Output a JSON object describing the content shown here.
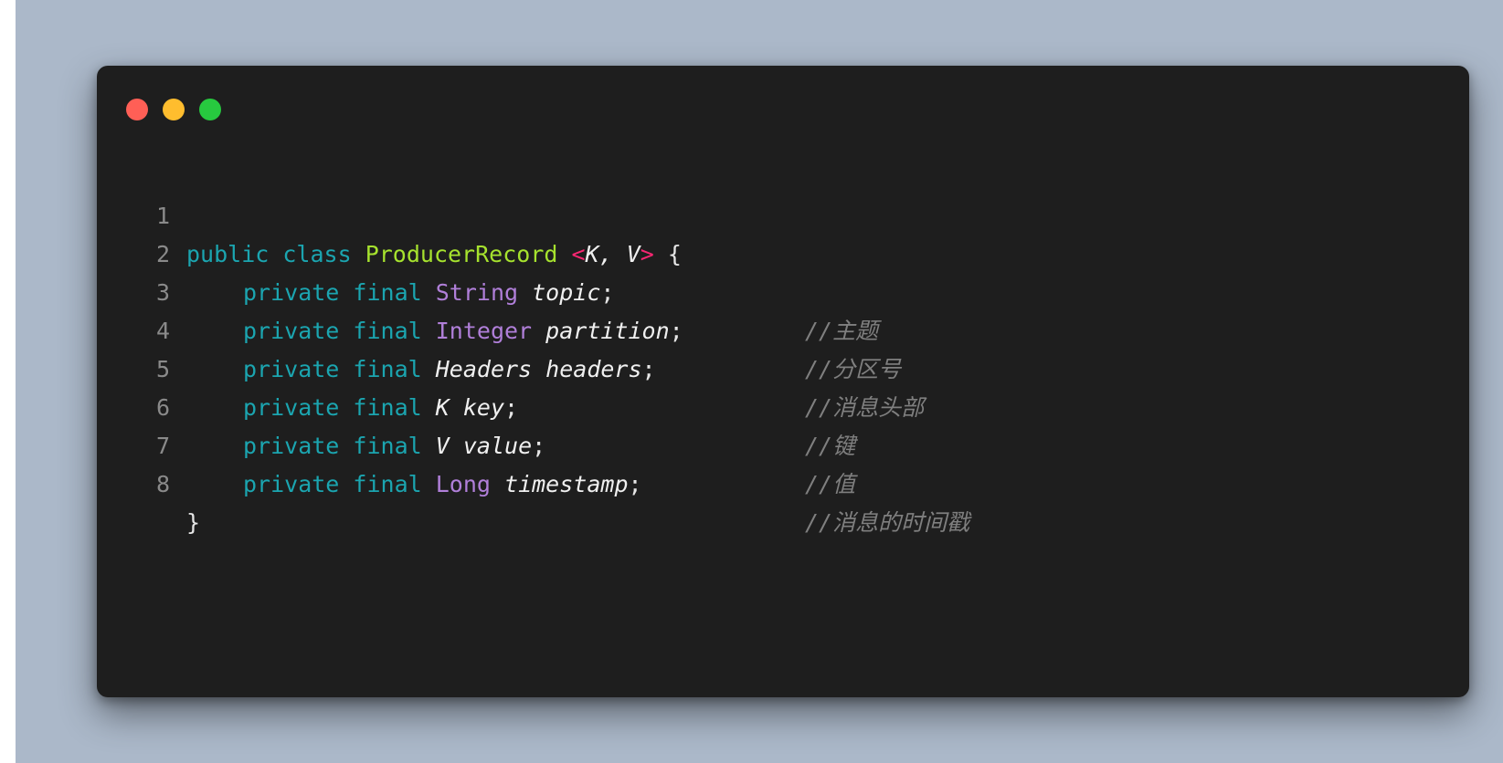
{
  "window": {
    "buttons": [
      {
        "name": "close",
        "color": "#ff5f56"
      },
      {
        "name": "minimize",
        "color": "#ffbd2e"
      },
      {
        "name": "maximize",
        "color": "#27c93f"
      }
    ]
  },
  "code": {
    "lines": [
      {
        "n": "1",
        "kw1": "public",
        "kw2": "class",
        "cls": "ProducerRecord",
        "lt": "<",
        "gen": "K, V",
        "gt": ">",
        "brace": "{"
      },
      {
        "n": "2",
        "kw1": "private",
        "kw2": "final",
        "type": "String",
        "name": "topic",
        "semi": ";",
        "comment": "//主题"
      },
      {
        "n": "3",
        "kw1": "private",
        "kw2": "final",
        "type": "Integer",
        "name": "partition",
        "semi": ";",
        "comment": "//分区号"
      },
      {
        "n": "4",
        "kw1": "private",
        "kw2": "final",
        "type": "Headers",
        "name": "headers",
        "semi": ";",
        "comment": "//消息头部"
      },
      {
        "n": "5",
        "kw1": "private",
        "kw2": "final",
        "type": "K",
        "name": "key",
        "semi": ";",
        "comment": "//键"
      },
      {
        "n": "6",
        "kw1": "private",
        "kw2": "final",
        "type": "V",
        "name": "value",
        "semi": ";",
        "comment": "//值"
      },
      {
        "n": "7",
        "kw1": "private",
        "kw2": "final",
        "type": "Long",
        "name": "timestamp",
        "semi": ";",
        "comment": "//消息的时间戳"
      },
      {
        "n": "8",
        "brace": "}"
      }
    ]
  }
}
